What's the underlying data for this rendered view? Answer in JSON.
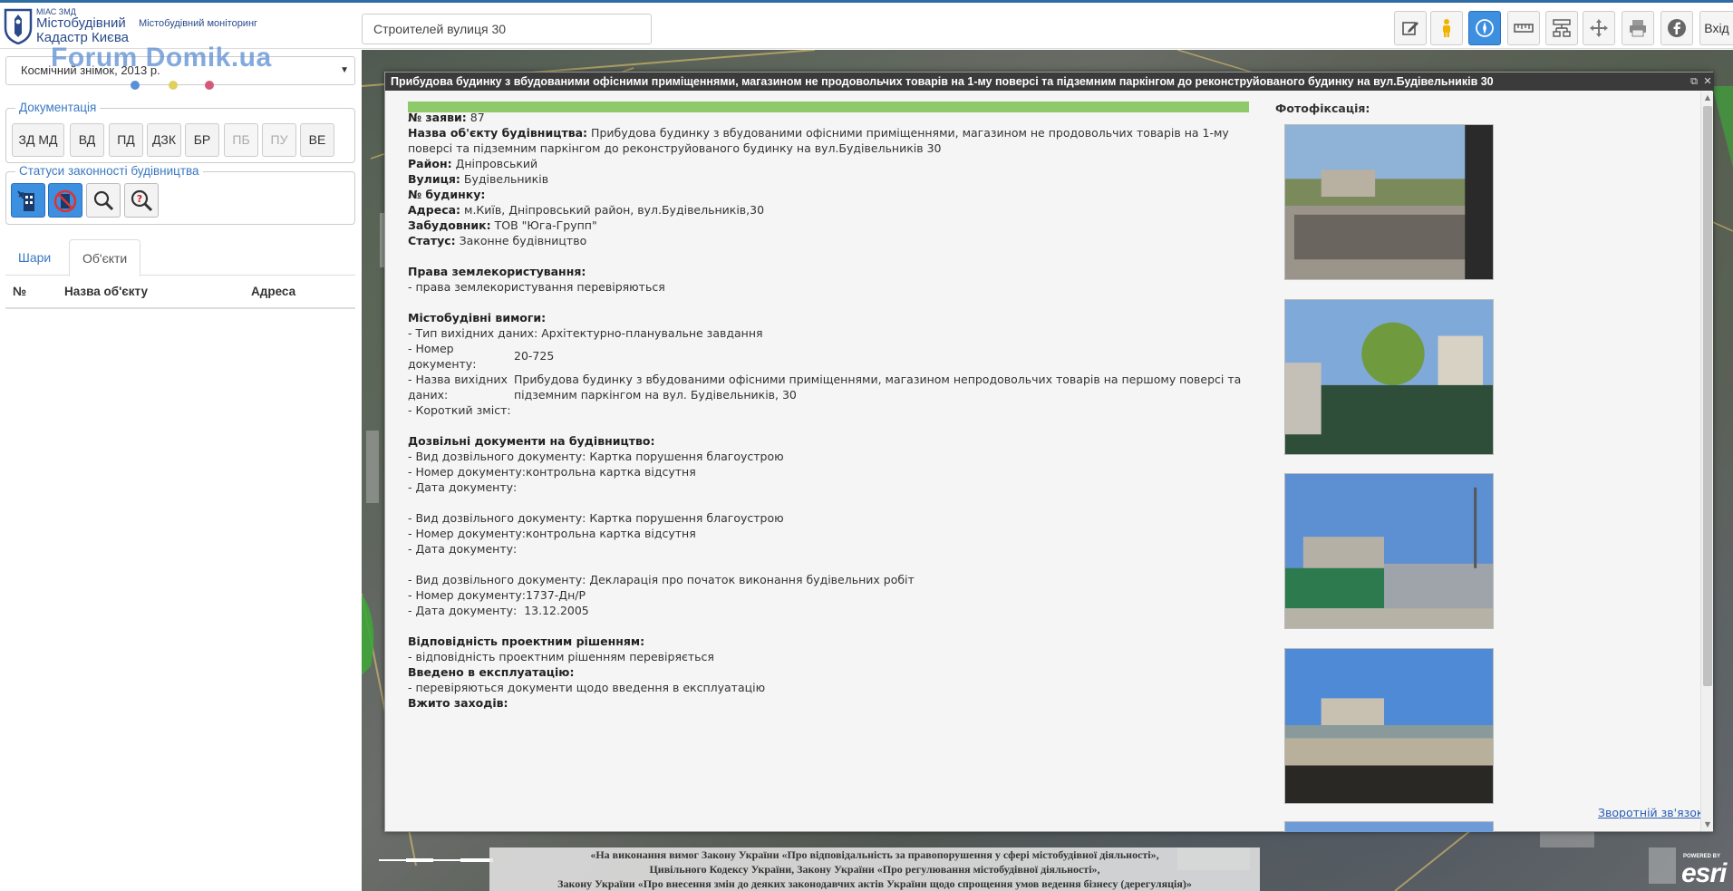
{
  "header": {
    "brand_small": "МІАС ЗМД",
    "brand_line1": "Містобудівний",
    "brand_line2": "Кадастр Києва",
    "brand_sub": "Містобудівний моніторинг",
    "search_value": "Строителей вулиця 30",
    "login_label": "Вхід",
    "tools": [
      "edit-icon",
      "pegman-icon",
      "compass-icon",
      "ruler-icon",
      "layers-tree-icon",
      "move-icon",
      "print-icon",
      "facebook-icon"
    ]
  },
  "sidebar": {
    "basemap_value": "Космічний знімок, 2013 р.",
    "watermark": "Forum Domik.ua",
    "dot_colors": [
      "#5a8fd8",
      "#e0d060",
      "#d45a7a"
    ],
    "documentation_legend": "Документація",
    "doc_buttons": [
      {
        "label": "ЗД МД",
        "enabled": true
      },
      {
        "label": "ВД",
        "enabled": true
      },
      {
        "label": "ПД",
        "enabled": true
      },
      {
        "label": "ДЗК",
        "enabled": true
      },
      {
        "label": "БР",
        "enabled": true
      },
      {
        "label": "ПБ",
        "enabled": false
      },
      {
        "label": "ПУ",
        "enabled": false
      },
      {
        "label": "ВЕ",
        "enabled": true
      }
    ],
    "status_legend": "Статуси законності будівництва",
    "status_buttons": [
      "legal-building-icon",
      "illegal-building-icon",
      "search-icon",
      "help-search-icon"
    ],
    "tabs": [
      "Шари",
      "Об'єкти"
    ],
    "selected_tab": "Об'єкти",
    "table_headers": [
      "№",
      "Назва об'єкту",
      "Адреса"
    ]
  },
  "popup": {
    "title": "Прибудова будинку з вбудованими офісними приміщеннями, магазином не продовольчих товарів на 1-му поверсі та підземним паркінгом до реконструйованого будинку на вул.Будівельників 30",
    "application_no_label": "№ заяви:",
    "application_no": "87",
    "object_name_label": "Назва об'єкту будівництва:",
    "object_name": "Прибудова будинку з вбудованими офісними приміщеннями, магазином не продовольчих товарів на 1-му поверсі та підземним паркінгом до реконструйованого будинку на вул.Будівельників 30",
    "district_label": "Район:",
    "district": "Дніпровський",
    "street_label": "Вулиця:",
    "street": "Будівельників",
    "building_no_label": "№ будинку:",
    "address_label": "Адреса:",
    "address": "м.Київ, Дніпровський район, вул.Будівельників,30",
    "developer_label": "Забудовник:",
    "developer": "ТОВ \"Юга-Групп\"",
    "status_label": "Статус:",
    "status": "Законне будівництво",
    "land_rights_heading": "Права землекористування:",
    "land_rights_text": "- права землекористування перевіряються",
    "urban_req_heading": "Містобудівні вимоги:",
    "urban_req_type": "- Тип вихідних даних: Архітектурно-планувальне завдання",
    "urban_req_docno_label": "- Номер документу:",
    "urban_req_docno": "20-725",
    "urban_req_name_label": "- Назва вихідних даних:",
    "urban_req_name": "Прибудова будинку з вбудованими офісними приміщеннями, магазином непродовольчих товарів на першому поверсі та підземним паркінгом на вул. Будівельників, 30",
    "urban_req_summary_label": "- Короткий зміст:",
    "permits_heading": "Дозвільні документи на будівництво:",
    "permits": [
      {
        "type": "- Вид дозвільного документу: Картка порушення благоустрою",
        "number": "- Номер документу:контрольна картка відсутня",
        "date": "- Дата документу:"
      },
      {
        "type": "- Вид дозвільного документу: Картка порушення благоустрою",
        "number": "- Номер документу:контрольна картка відсутня",
        "date": "- Дата документу:"
      },
      {
        "type": "- Вид дозвільного документу: Декларація про початок виконання будівельних робіт",
        "number": "- Номер документу:1737-Дн/Р",
        "date": "- Дата документу:  13.12.2005"
      }
    ],
    "compliance_heading": "Відповідність проектним рішенням:",
    "compliance_text": "- відповідність проектним рішенням перевіряється",
    "commissioning_heading": "Введено в експлуатацію:",
    "commissioning_text": "- перевіряються документи щодо введення в експлуатацію",
    "measures_heading": "Вжито заходів:",
    "photos_label": "Фотофіксація:",
    "feedback_link": "Зворотній зв'язок"
  },
  "legal_notice": {
    "line1": "«На виконання вимог Закону України «Про відповідальність за правопорушення у сфері містобудівної діяльності»,",
    "line2": "Цивільного Кодексу України, Закону України «Про регулювання містобудівної діяльності»,",
    "line3": "Закону України «Про внесення змін до деяких законодавчих актів України щодо спрощення умов ведення бізнесу (дерегуляція)»"
  },
  "attribution": {
    "powered_by": "POWERED BY",
    "esri": "esri"
  },
  "colors": {
    "accent": "#3a78c2",
    "active_button": "#3d8fe0",
    "status_bar": "#8fca6a",
    "popup_title_bg": "#3b3b3b"
  }
}
